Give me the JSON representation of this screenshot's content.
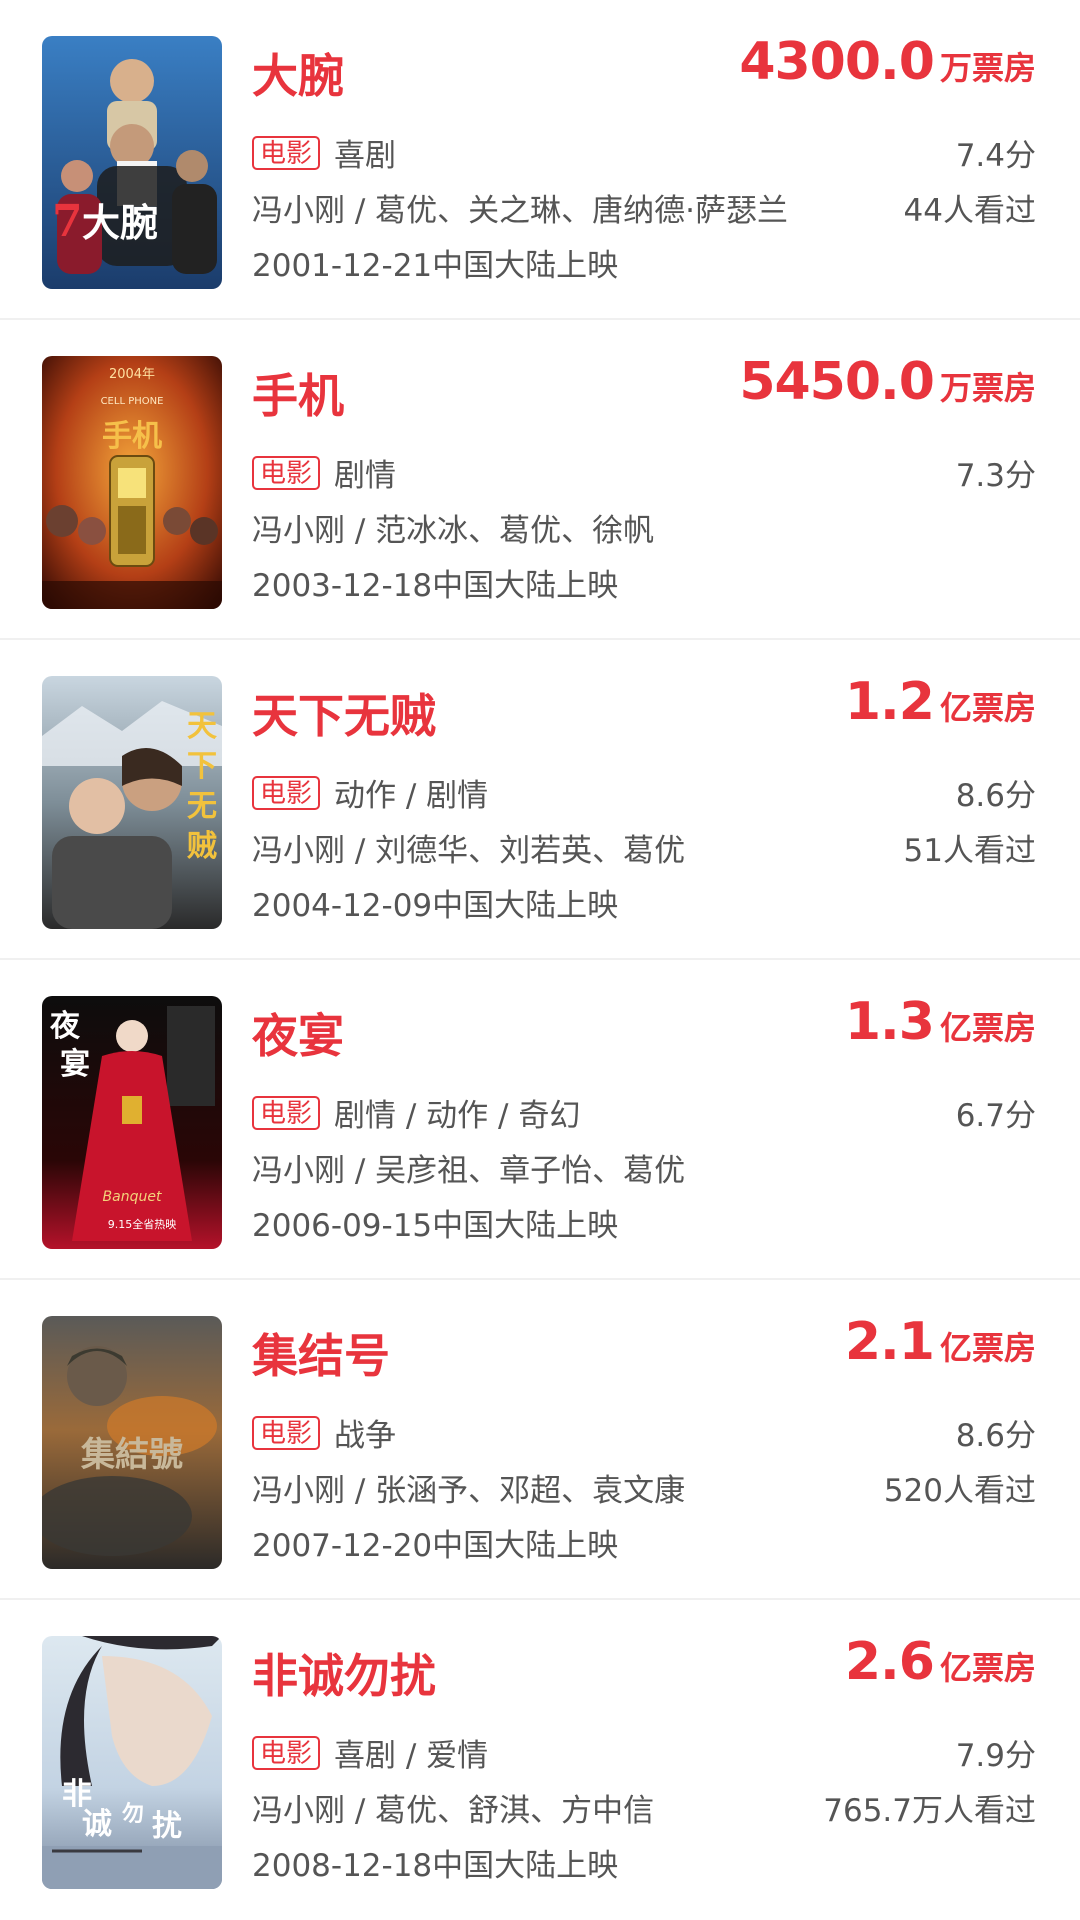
{
  "movies": [
    {
      "title": "大腕",
      "box_value": "4300.0",
      "box_unit": "万票房",
      "tag": "电影",
      "genre": "喜剧",
      "rating": "7.4分",
      "cast": "冯小刚 / 葛优、关之琳、唐纳德·萨瑟兰",
      "watched": "44人看过",
      "release": "2001-12-21中国大陆上映",
      "poster_text": "大腕"
    },
    {
      "title": "手机",
      "box_value": "5450.0",
      "box_unit": "万票房",
      "tag": "电影",
      "genre": "剧情",
      "rating": "7.3分",
      "cast": "冯小刚 / 范冰冰、葛优、徐帆",
      "watched": "",
      "release": "2003-12-18中国大陆上映",
      "poster_text": "手机",
      "poster_small": "2004年",
      "poster_caption": "CELL PHONE"
    },
    {
      "title": "天下无贼",
      "box_value": "1.2",
      "box_unit": "亿票房",
      "tag": "电影",
      "genre": "动作 / 剧情",
      "rating": "8.6分",
      "cast": "冯小刚 / 刘德华、刘若英、葛优",
      "watched": "51人看过",
      "release": "2004-12-09中国大陆上映",
      "poster_text": "天下无贼"
    },
    {
      "title": "夜宴",
      "box_value": "1.3",
      "box_unit": "亿票房",
      "tag": "电影",
      "genre": "剧情 / 动作 / 奇幻",
      "rating": "6.7分",
      "cast": "冯小刚 / 吴彦祖、章子怡、葛优",
      "watched": "",
      "release": "2006-09-15中国大陆上映",
      "poster_text": "夜宴",
      "poster_caption": "Banquet",
      "poster_date": "9.15全省热映"
    },
    {
      "title": "集结号",
      "box_value": "2.1",
      "box_unit": "亿票房",
      "tag": "电影",
      "genre": "战争",
      "rating": "8.6分",
      "cast": "冯小刚 / 张涵予、邓超、袁文康",
      "watched": "520人看过",
      "release": "2007-12-20中国大陆上映",
      "poster_text": "集結號"
    },
    {
      "title": "非诚勿扰",
      "box_value": "2.6",
      "box_unit": "亿票房",
      "tag": "电影",
      "genre": "喜剧 / 爱情",
      "rating": "7.9分",
      "cast": "冯小刚 / 葛优、舒淇、方中信",
      "watched": "765.7万人看过",
      "release": "2008-12-18中国大陆上映",
      "poster_text": "非诚勿扰"
    }
  ],
  "colors": {
    "accent": "#e8343d",
    "text": "#555555",
    "divider": "#f0f0f0"
  }
}
